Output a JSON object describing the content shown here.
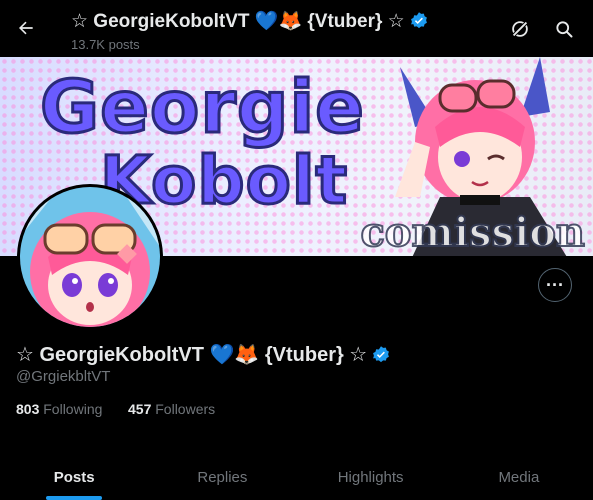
{
  "header": {
    "title": "☆ GeorgieKoboltVT 💙🦊 {Vtuber} ☆",
    "posts_count": "13.7K posts",
    "icons": [
      "back-arrow-icon",
      "broken-circle-icon",
      "search-icon",
      "verified-badge-icon"
    ]
  },
  "banner": {
    "line1": "Georgie",
    "line2": "Kobolt",
    "watermark": "comission"
  },
  "profile": {
    "display_name": "☆ GeorgieKoboltVT 💙🦊 {Vtuber} ☆",
    "handle": "@GrgiekbltVT",
    "following_count": "803",
    "following_label": "Following",
    "followers_count": "457",
    "followers_label": "Followers",
    "more_label": "···"
  },
  "tabs": [
    {
      "label": "Posts",
      "active": true
    },
    {
      "label": "Replies",
      "active": false
    },
    {
      "label": "Highlights",
      "active": false
    },
    {
      "label": "Media",
      "active": false
    }
  ],
  "colors": {
    "accent": "#1d9bf0",
    "background": "#000000",
    "muted_text": "#71767b",
    "text": "#e7e9ea"
  }
}
